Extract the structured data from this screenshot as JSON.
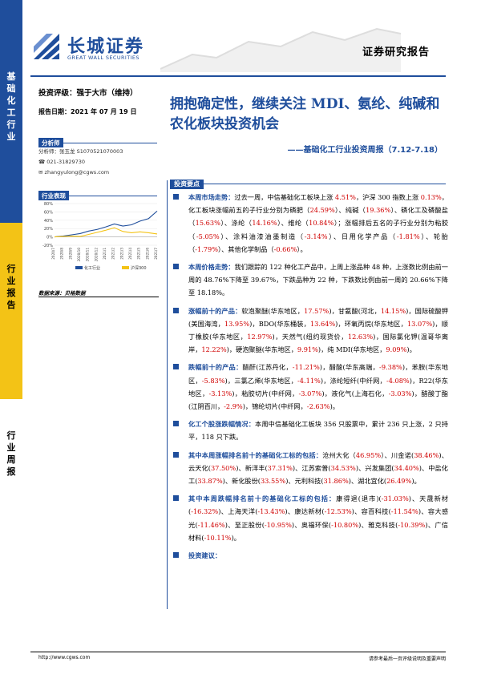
{
  "sidebar": {
    "blue_text": "基础化工行业",
    "yellow_text": "行业报告",
    "white_text": "行业周报"
  },
  "header": {
    "logo_cn": "长城证券",
    "logo_en": "GREAT WALL SECURITIES",
    "report_type": "证券研究报告"
  },
  "info": {
    "rating": "投资评级：强于大市（维持）",
    "date": "报告日期：2021 年 07 月 19 日",
    "analyst_label": "分析师",
    "analyst": "分析师：张玉龙  S1070521070003",
    "phone": "021-31829730",
    "email": "zhangyulong@cgws.com",
    "perf_label": "行业表现",
    "source": "数据来源：贝格数据"
  },
  "chart_data": {
    "type": "line",
    "categories": [
      "2020/7",
      "2020/8",
      "2020/9",
      "2020/10",
      "2020/11",
      "2020/12",
      "2021/1",
      "2021/2",
      "2021/3",
      "2021/4",
      "2021/5",
      "2021/6",
      "2021/7"
    ],
    "series": [
      {
        "name": "化工行业",
        "values": [
          0,
          2,
          5,
          8,
          14,
          18,
          24,
          31,
          26,
          29,
          38,
          44,
          62
        ]
      },
      {
        "name": "沪深300",
        "values": [
          0,
          1,
          2,
          1,
          6,
          11,
          16,
          22,
          13,
          10,
          12,
          10,
          7
        ]
      }
    ],
    "yticks": [
      "80%",
      "60%",
      "40%",
      "20%",
      "0%",
      "-20%"
    ],
    "ylim": [
      -20,
      80
    ],
    "colors": {
      "化工行业": "#1f4e9c",
      "沪深300": "#f3c316"
    }
  },
  "main": {
    "title": "拥抱确定性，继续关注 MDI、氨纶、纯碱和农化板块投资机会",
    "subtitle": "——基础化工行业投资周报（7.12-7.18）",
    "key_label": "投资要点"
  },
  "footer": {
    "url": "http://www.cgws.com",
    "note": "请参考最后一页评级说明及重要声明"
  }
}
